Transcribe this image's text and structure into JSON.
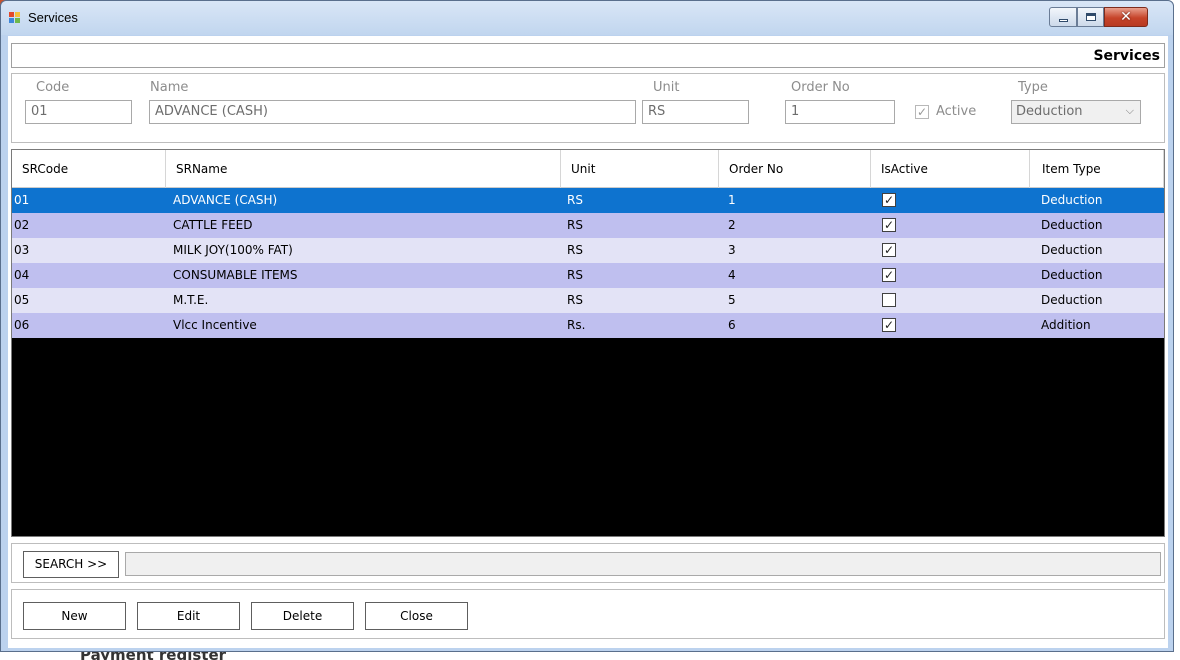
{
  "window": {
    "title": "Services"
  },
  "header": {
    "title": "Services"
  },
  "form": {
    "code_label": "Code",
    "code_value": "01",
    "name_label": "Name",
    "name_value": "ADVANCE (CASH)",
    "unit_label": "Unit",
    "unit_value": "RS",
    "order_label": "Order No",
    "order_value": "1",
    "active_label": "Active",
    "active_checked": true,
    "type_label": "Type",
    "type_value": "Deduction"
  },
  "grid": {
    "columns": [
      "SRCode",
      "SRName",
      "Unit",
      "Order No",
      "IsActive",
      "Item Type"
    ],
    "rows": [
      {
        "code": "01",
        "name": "ADVANCE (CASH)",
        "unit": "RS",
        "order": "1",
        "check": "✓",
        "type": "Deduction"
      },
      {
        "code": "02",
        "name": "CATTLE FEED",
        "unit": "RS",
        "order": "2",
        "check": "✓",
        "type": "Deduction"
      },
      {
        "code": "03",
        "name": "MILK JOY(100% FAT)",
        "unit": "RS",
        "order": "3",
        "check": "✓",
        "type": "Deduction"
      },
      {
        "code": "04",
        "name": "CONSUMABLE ITEMS",
        "unit": "RS",
        "order": "4",
        "check": "✓",
        "type": "Deduction"
      },
      {
        "code": "05",
        "name": "M.T.E.",
        "unit": "RS",
        "order": "5",
        "check": "",
        "type": "Deduction"
      },
      {
        "code": "06",
        "name": "Vlcc Incentive",
        "unit": "Rs.",
        "order": "6",
        "check": "✓",
        "type": "Addition"
      }
    ]
  },
  "search": {
    "button_label": "SEARCH >>",
    "value": ""
  },
  "buttons": {
    "new": "New",
    "edit": "Edit",
    "delete": "Delete",
    "close": "Close"
  },
  "background": {
    "partial_text": "Payment register"
  },
  "icons": {
    "app": "window-app-icon",
    "min": "minimize-icon",
    "max": "maximize-icon",
    "close": "close-icon",
    "check": "check-icon",
    "dropdown": "chevron-down-icon"
  }
}
